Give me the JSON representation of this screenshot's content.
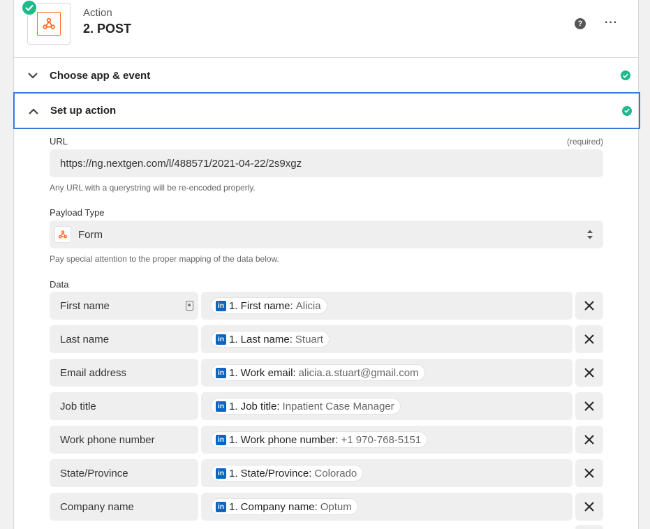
{
  "header": {
    "step_label": "Action",
    "step_title": "2. POST",
    "help_icon": "question-icon",
    "more_icon": "ellipsis-icon"
  },
  "sections": {
    "choose": {
      "label": "Choose app & event"
    },
    "setup": {
      "label": "Set up action"
    }
  },
  "url": {
    "label": "URL",
    "required": "(required)",
    "value": "https://ng.nextgen.com/l/488571/2021-04-22/2s9xgz",
    "hint": "Any URL with a querystring will be re-encoded properly."
  },
  "payload": {
    "label": "Payload Type",
    "value": "Form",
    "hint": "Pay special attention to the proper mapping of the data below."
  },
  "data": {
    "label": "Data",
    "rows": [
      {
        "key": "First name",
        "field": "1. First name:",
        "value": "Alicia"
      },
      {
        "key": "Last name",
        "field": "1. Last name:",
        "value": "Stuart"
      },
      {
        "key": "Email address",
        "field": "1. Work email:",
        "value": "alicia.a.stuart@gmail.com"
      },
      {
        "key": "Job title",
        "field": "1. Job title:",
        "value": "Inpatient Case Manager"
      },
      {
        "key": "Work phone number",
        "field": "1. Work phone number:",
        "value": "+1 970-768-5151"
      },
      {
        "key": "State/Province",
        "field": "1. State/Province:",
        "value": "Colorado"
      },
      {
        "key": "Company name",
        "field": "1. Company name:",
        "value": "Optum"
      }
    ]
  },
  "colors": {
    "accent": "#3d77d9",
    "success": "#1eb98d",
    "webhook": "#ff6a1f",
    "linkedin": "#0a66c2"
  }
}
